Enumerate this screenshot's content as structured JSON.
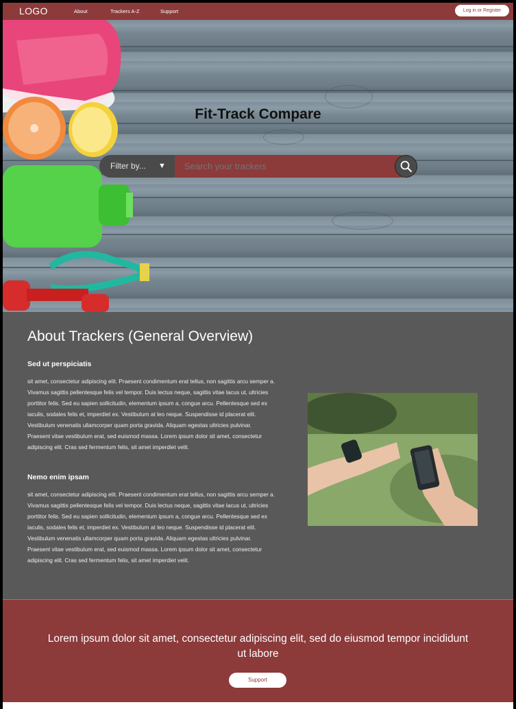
{
  "nav": {
    "logo": "LOGO",
    "links": [
      "About",
      "Trackers A-Z",
      "Support"
    ],
    "login": "Log in or Register"
  },
  "hero": {
    "title": "Fit-Track Compare",
    "filter_label": "Filter by...",
    "search_placeholder": "Search your trackers"
  },
  "about": {
    "title": "About Trackers (General Overview)",
    "sections": [
      {
        "heading": "Sed ut perspiciatis",
        "body": "sit amet, consectetur adipiscing elit. Praesent condimentum erat tellus, non sagittis arcu semper a. Vivamus sagittis pellentesque felis vel tempor. Duis lectus neque, sagittis vitae lacus ut, ultricies porttitor felis. Sed eu sapien sollicitudin, elementum ipsum a, congue arcu. Pellentesque sed ex iaculis, sodales felis et, imperdiet ex. Vestibulum at leo neque. Suspendisse id placerat elit. Vestibulum venenatis ullamcorper quam porta gravida. Aliquam egestas ultricies pulvinar. Praesent vitae vestibulum erat, sed euismod massa. Lorem ipsum dolor sit amet, consectetur adipiscing elit. Cras sed fermentum felis, sit amet imperdiet velit."
      },
      {
        "heading": "Nemo enim ipsam",
        "body": "sit amet, consectetur adipiscing elit. Praesent condimentum erat tellus, non sagittis arcu semper a. Vivamus sagittis pellentesque felis vel tempor. Duis lectus neque, sagittis vitae lacus ut, ultricies porttitor felis. Sed eu sapien sollicitudin, elementum ipsum a, congue arcu. Pellentesque sed ex iaculis, sodales felis et, imperdiet ex. Vestibulum at leo neque. Suspendisse id placerat elit. Vestibulum venenatis ullamcorper quam porta gravida. Aliquam egestas ultricies pulvinar. Praesent vitae vestibulum erat, sed euismod massa. Lorem ipsum dolor sit amet, consectetur adipiscing elit. Cras sed fermentum felis, sit amet imperdiet velit."
      }
    ]
  },
  "cta": {
    "text": "Lorem ipsum dolor sit amet, consectetur adipiscing elit, sed do eiusmod tempor incididunt ut labore",
    "button": "Support"
  },
  "icons": {
    "search": "search-icon",
    "filter_arrow": "chevron-down-icon"
  },
  "colors": {
    "brand": "#8c3a3a",
    "dark": "#595959",
    "search_dark": "#4a4a4a"
  }
}
